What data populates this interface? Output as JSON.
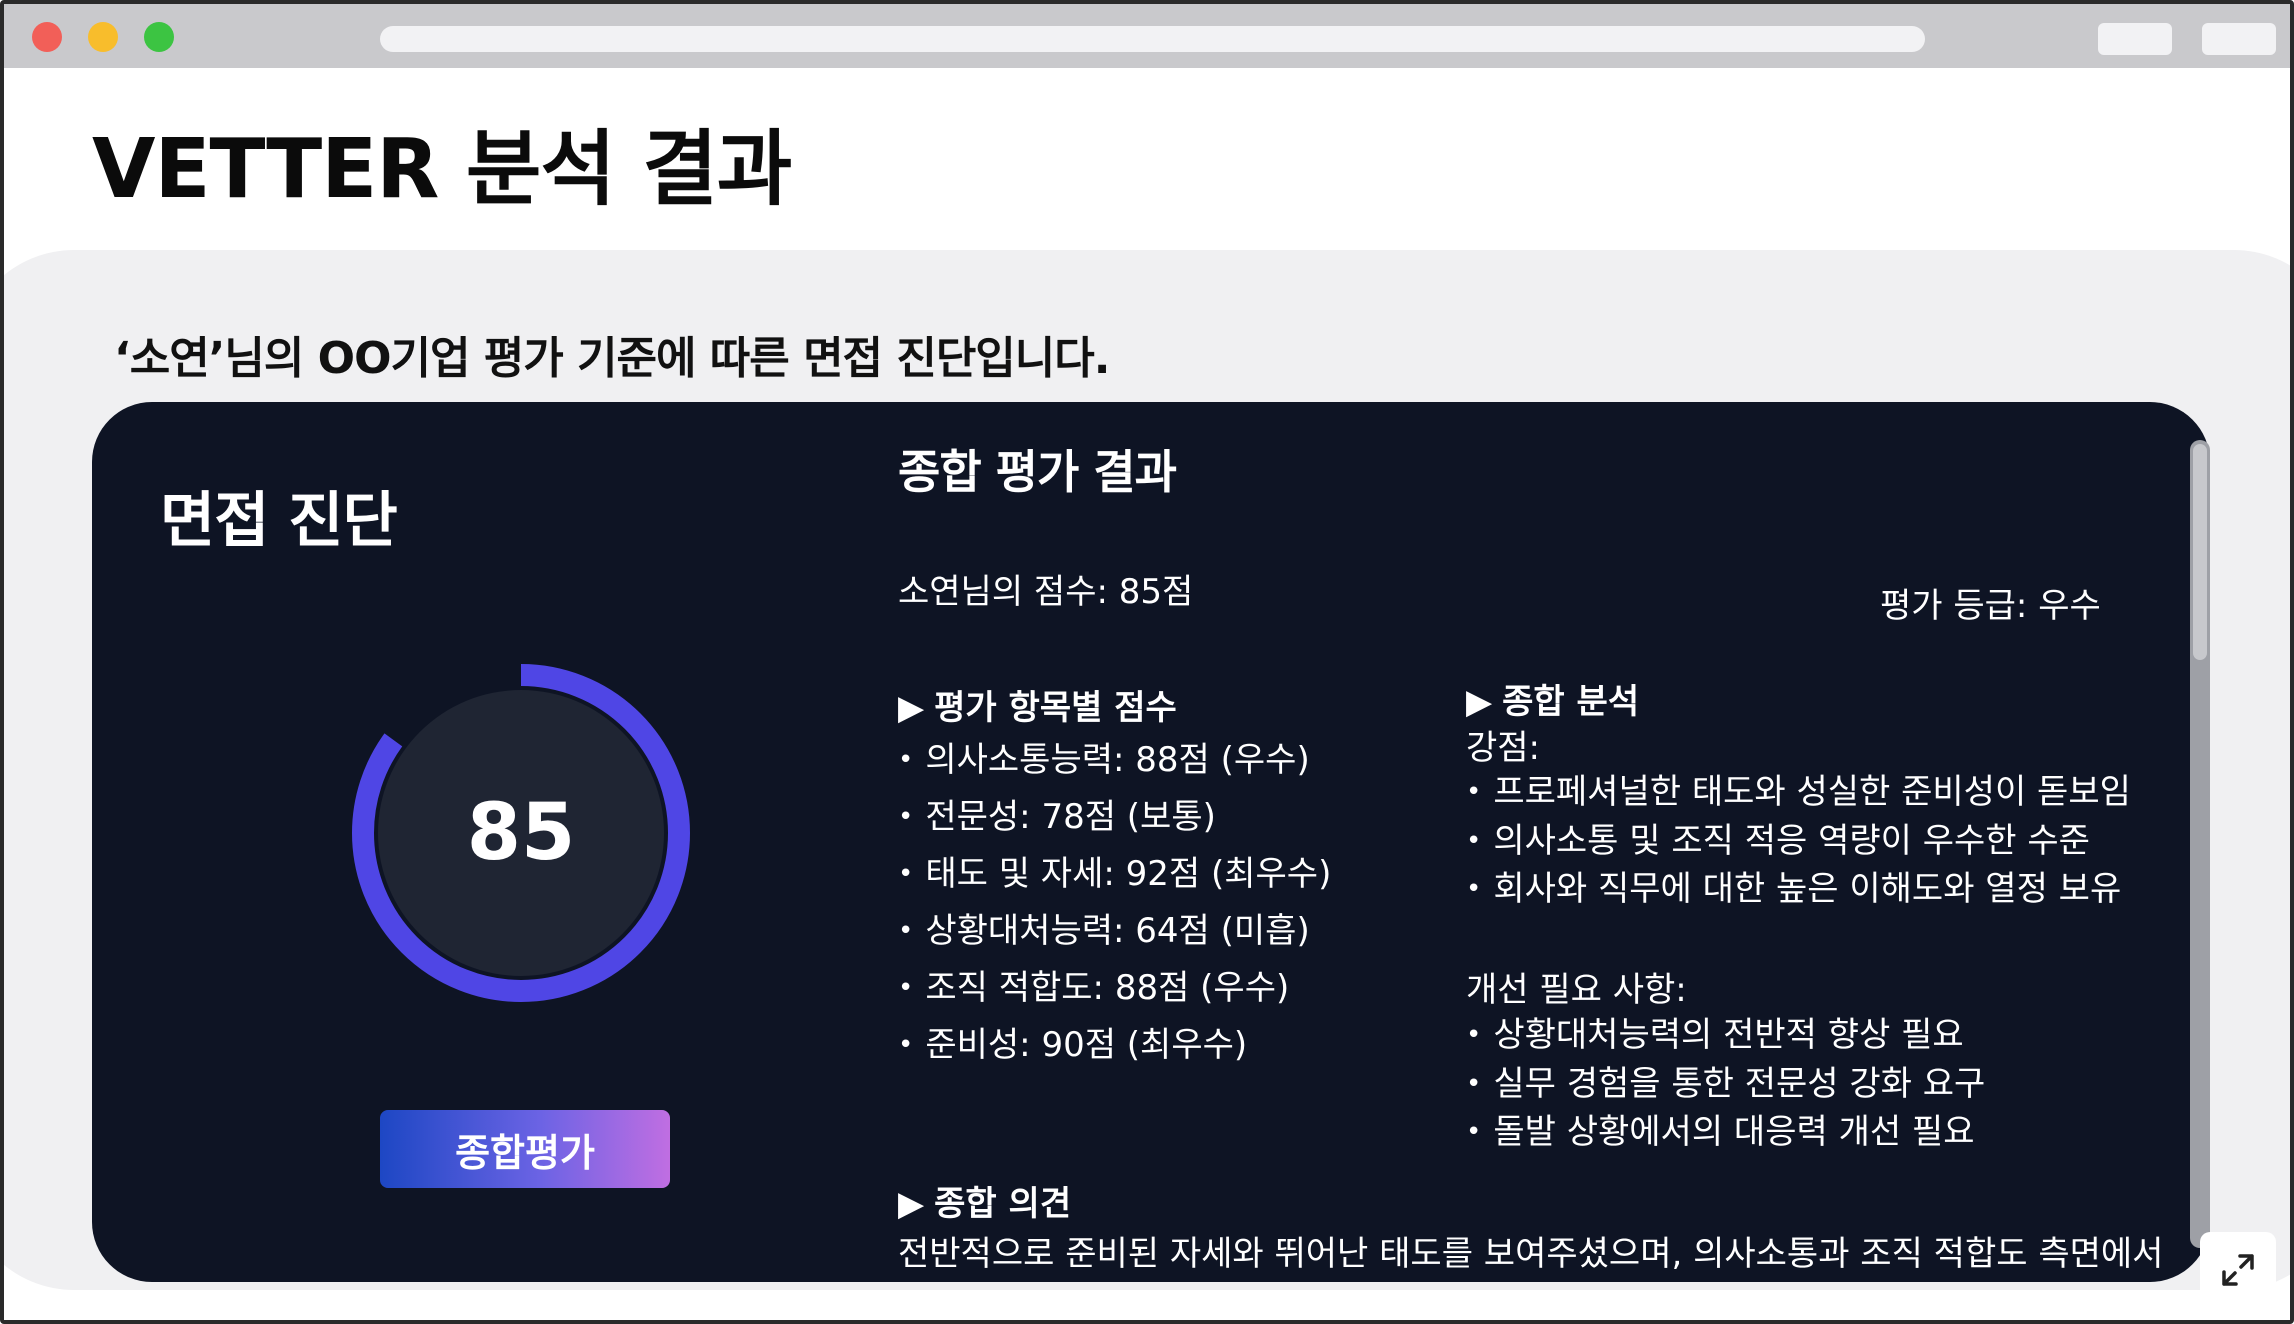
{
  "page": {
    "title": "VETTER 분석 결과",
    "subtitle": "‘소연’님의 OO기업 평가 기준에 따른 면접 진단입니다."
  },
  "left_panel": {
    "heading": "면접 진단",
    "gauge": {
      "value": "85",
      "fill_fraction": 0.85,
      "color": "#4f46e5"
    },
    "summary_button_label": "종합평가"
  },
  "results": {
    "title": "종합 평가 결과",
    "score_text": "소연님의 점수: 85점",
    "grade_text": "평가 등급: 우수",
    "item_scores": {
      "heading": "평가 항목별 점수",
      "items": [
        "의사소통능력: 88점 (우수)",
        "전문성: 78점 (보통)",
        "태도 및 자세: 92점 (최우수)",
        "상황대처능력: 64점 (미흡)",
        "조직 적합도: 88점 (우수)",
        "준비성: 90점 (최우수)"
      ]
    },
    "analysis": {
      "heading": "종합 분석",
      "strengths_label": "강점:",
      "strengths": [
        "프로페셔널한 태도와 성실한 준비성이 돋보임",
        "의사소통 및 조직 적응 역량이 우수한 수준",
        "회사와 직무에 대한 높은 이해도와 열정 보유"
      ],
      "improvements_label": "개선 필요 사항:",
      "improvements": [
        "상황대처능력의 전반적 향상 필요",
        "실무 경험을 통한 전문성 강화 요구",
        "돌발 상황에서의 대응력 개선 필요"
      ]
    },
    "opinion": {
      "heading": "종합 의견",
      "text": "전반적으로 준비된 자세와 뛰어난 태도를 보여주셨으며, 의사소통과 조직 적합도 측면에서"
    }
  },
  "icons": {
    "triangle": "play-triangle-icon",
    "expand": "expand-icon"
  }
}
